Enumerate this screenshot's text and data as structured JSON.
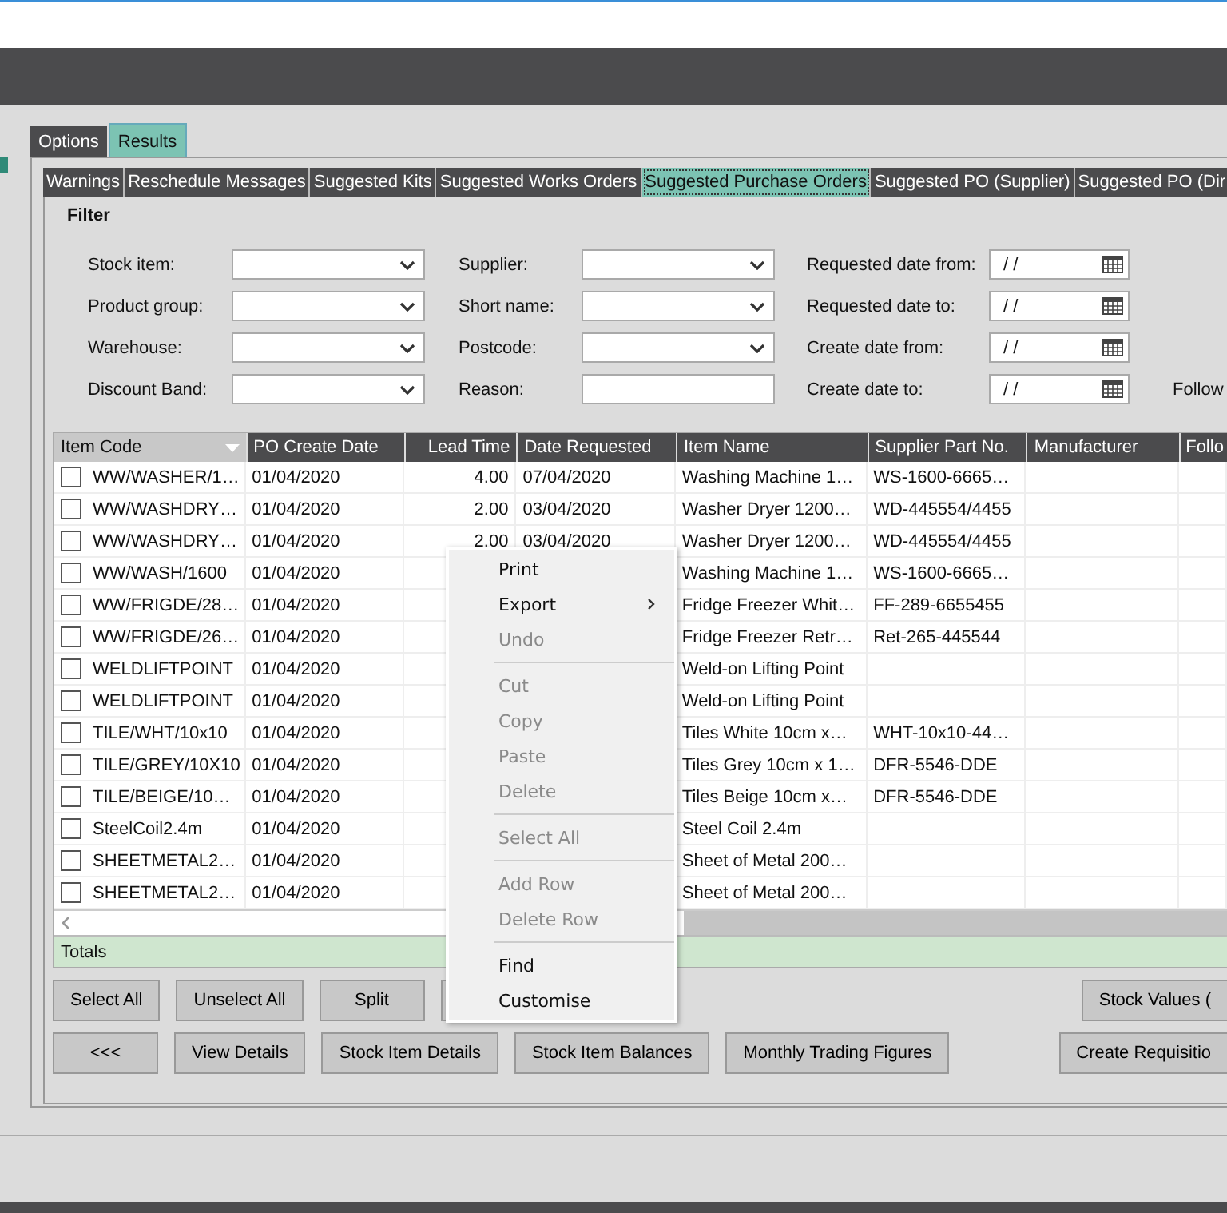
{
  "outer_tabs": [
    {
      "label": "Options",
      "selected": false
    },
    {
      "label": "Results",
      "selected": true
    }
  ],
  "inner_tabs": [
    {
      "label": "Warnings",
      "selected": false
    },
    {
      "label": "Reschedule Messages",
      "selected": false
    },
    {
      "label": "Suggested Kits",
      "selected": false
    },
    {
      "label": "Suggested Works Orders",
      "selected": false
    },
    {
      "label": "Suggested Purchase Orders",
      "selected": true
    },
    {
      "label": "Suggested PO (Supplier)",
      "selected": false
    },
    {
      "label": "Suggested PO (Dir",
      "selected": false
    }
  ],
  "filter": {
    "title": "Filter",
    "rows": [
      [
        {
          "label": "Stock item:",
          "kind": "dropdown"
        },
        {
          "label": "Supplier:",
          "kind": "dropdown"
        },
        {
          "label": "Requested date from:",
          "kind": "date",
          "value": "/ /"
        }
      ],
      [
        {
          "label": "Product group:",
          "kind": "dropdown"
        },
        {
          "label": "Short name:",
          "kind": "dropdown"
        },
        {
          "label": "Requested date to:",
          "kind": "date",
          "value": "/ /"
        }
      ],
      [
        {
          "label": "Warehouse:",
          "kind": "dropdown"
        },
        {
          "label": "Postcode:",
          "kind": "dropdown"
        },
        {
          "label": "Create date from:",
          "kind": "date",
          "value": "/ /"
        }
      ],
      [
        {
          "label": "Discount Band:",
          "kind": "dropdown"
        },
        {
          "label": "Reason:",
          "kind": "text"
        },
        {
          "label": "Create date to:",
          "kind": "date",
          "value": "/ /"
        },
        {
          "label": "Follow",
          "kind": "label"
        }
      ]
    ]
  },
  "table": {
    "columns": [
      {
        "label": "Item Code",
        "kind": "text",
        "sorted": true
      },
      {
        "label": "PO Create Date",
        "kind": "text",
        "sorted": false
      },
      {
        "label": "Lead Time",
        "kind": "number",
        "sorted": false
      },
      {
        "label": "Date Requested",
        "kind": "text",
        "sorted": false
      },
      {
        "label": "Item Name",
        "kind": "text",
        "sorted": false
      },
      {
        "label": "Supplier Part No.",
        "kind": "text",
        "sorted": false
      },
      {
        "label": "Manufacturer",
        "kind": "text",
        "sorted": false
      },
      {
        "label": "Follo",
        "kind": "text",
        "sorted": false
      }
    ],
    "rows": [
      {
        "checked": false,
        "cells": [
          "WW/WASHER/1…",
          "01/04/2020",
          "4.00",
          "07/04/2020",
          "Washing Machine 1…",
          "WS-1600-6665…",
          "",
          ""
        ]
      },
      {
        "checked": false,
        "cells": [
          "WW/WASHDRY…",
          "01/04/2020",
          "2.00",
          "03/04/2020",
          "Washer Dryer 1200…",
          "WD-445554/4455",
          "",
          ""
        ]
      },
      {
        "checked": false,
        "cells": [
          "WW/WASHDRY…",
          "01/04/2020",
          "2.00",
          "03/04/2020",
          "Washer Dryer 1200…",
          "WD-445554/4455",
          "",
          ""
        ]
      },
      {
        "checked": false,
        "cells": [
          "WW/WASH/1600",
          "01/04/2020",
          "",
          "",
          "Washing Machine 1…",
          "WS-1600-6665…",
          "",
          ""
        ]
      },
      {
        "checked": false,
        "cells": [
          "WW/FRIGDE/28…",
          "01/04/2020",
          "",
          "",
          "Fridge Freezer Whit…",
          "FF-289-6655455",
          "",
          ""
        ]
      },
      {
        "checked": false,
        "cells": [
          "WW/FRIGDE/26…",
          "01/04/2020",
          "",
          "",
          "Fridge Freezer Retr…",
          "Ret-265-445544",
          "",
          ""
        ]
      },
      {
        "checked": false,
        "cells": [
          "WELDLIFTPOINT",
          "01/04/2020",
          "",
          "",
          "Weld-on Lifting Point",
          "",
          "",
          ""
        ]
      },
      {
        "checked": false,
        "cells": [
          "WELDLIFTPOINT",
          "01/04/2020",
          "",
          "",
          "Weld-on Lifting Point",
          "",
          "",
          ""
        ]
      },
      {
        "checked": false,
        "cells": [
          "TILE/WHT/10x10",
          "01/04/2020",
          "",
          "",
          "Tiles White 10cm x…",
          "WHT-10x10-44…",
          "",
          ""
        ]
      },
      {
        "checked": false,
        "cells": [
          "TILE/GREY/10X10",
          "01/04/2020",
          "",
          "",
          "Tiles Grey 10cm x 1…",
          "DFR-5546-DDE",
          "",
          ""
        ]
      },
      {
        "checked": false,
        "cells": [
          "TILE/BEIGE/10…",
          "01/04/2020",
          "",
          "",
          "Tiles Beige 10cm x…",
          "DFR-5546-DDE",
          "",
          ""
        ]
      },
      {
        "checked": false,
        "cells": [
          "SteelCoil2.4m",
          "01/04/2020",
          "",
          "",
          "Steel Coil 2.4m",
          "",
          "",
          ""
        ]
      },
      {
        "checked": false,
        "cells": [
          "SHEETMETAL2…",
          "01/04/2020",
          "",
          "",
          "Sheet of Metal 200…",
          "",
          "",
          ""
        ]
      },
      {
        "checked": false,
        "cells": [
          "SHEETMETAL2…",
          "01/04/2020",
          "",
          "",
          "Sheet of Metal 200…",
          "",
          "",
          ""
        ]
      }
    ],
    "totals_label": "Totals"
  },
  "context_menu": [
    {
      "kind": "item",
      "label": "Print",
      "disabled": false,
      "submenu": false
    },
    {
      "kind": "item",
      "label": "Export",
      "disabled": false,
      "submenu": true
    },
    {
      "kind": "item",
      "label": "Undo",
      "disabled": true,
      "submenu": false
    },
    {
      "kind": "separator"
    },
    {
      "kind": "item",
      "label": "Cut",
      "disabled": true,
      "submenu": false
    },
    {
      "kind": "item",
      "label": "Copy",
      "disabled": true,
      "submenu": false
    },
    {
      "kind": "item",
      "label": "Paste",
      "disabled": true,
      "submenu": false
    },
    {
      "kind": "item",
      "label": "Delete",
      "disabled": true,
      "submenu": false
    },
    {
      "kind": "separator"
    },
    {
      "kind": "item",
      "label": "Select All",
      "disabled": true,
      "submenu": false
    },
    {
      "kind": "separator"
    },
    {
      "kind": "item",
      "label": "Add Row",
      "disabled": true,
      "submenu": false
    },
    {
      "kind": "item",
      "label": "Delete Row",
      "disabled": true,
      "submenu": false
    },
    {
      "kind": "separator"
    },
    {
      "kind": "item",
      "label": "Find",
      "disabled": false,
      "submenu": false
    },
    {
      "kind": "item",
      "label": "Customise",
      "disabled": false,
      "submenu": false
    }
  ],
  "buttons_row_1": {
    "left": [
      {
        "label": "Select All"
      },
      {
        "label": "Unselect All"
      },
      {
        "label": "Split"
      },
      {
        "covered": true
      }
    ],
    "right": [
      {
        "label": "Stock Values ("
      }
    ]
  },
  "buttons_row_2": {
    "left": [
      {
        "label": "<<<"
      },
      {
        "label": "View Details"
      },
      {
        "label": "Stock Item Details"
      },
      {
        "label": "Stock Item Balances"
      },
      {
        "label": "Monthly Trading Figures"
      }
    ],
    "right": [
      {
        "label": "Create Requisitio"
      }
    ]
  }
}
